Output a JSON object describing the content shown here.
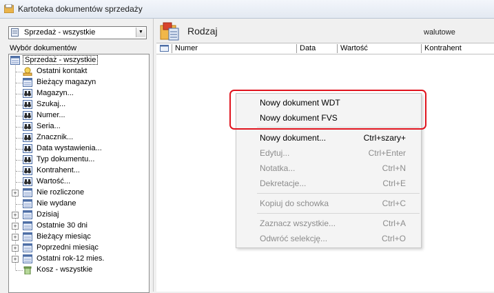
{
  "window": {
    "title": "Kartoteka dokumentów sprzedaży"
  },
  "left": {
    "combo_value": "Sprzedaż - wszystkie",
    "section_label": "Wybór dokumentów",
    "tree_root": "Sprzedaż - wszystkie",
    "tree_children": [
      "Ostatni kontakt",
      "Bieżący magazyn",
      "Magazyn...",
      "Szukaj...",
      "Numer...",
      "Seria...",
      "Znacznik...",
      "Data wystawienia...",
      "Typ dokumentu...",
      "Kontrahent...",
      "Wartość..."
    ],
    "tree_top": [
      "Nie rozliczone",
      "Nie wydane",
      "Dzisiaj",
      "Ostatnie 30 dni",
      "Bieżący miesiąc",
      "Poprzedni miesiąc",
      "Ostatni rok-12 mies.",
      "Kosz - wszystkie"
    ]
  },
  "right": {
    "title": "Rodzaj",
    "walutowe": "walutowe",
    "columns": [
      "Numer",
      "Data",
      "Wartość",
      "Kontrahent"
    ]
  },
  "context_menu": {
    "items": [
      {
        "label": "Nowy dokument WDT",
        "shortcut": ""
      },
      {
        "label": "Nowy dokument FVS",
        "shortcut": ""
      },
      {
        "label": "Nowy dokument...",
        "shortcut": "Ctrl+szary+"
      },
      {
        "label": "Edytuj...",
        "shortcut": "Ctrl+Enter"
      },
      {
        "label": "Notatka...",
        "shortcut": "Ctrl+N"
      },
      {
        "label": "Dekretacje...",
        "shortcut": "Ctrl+E"
      },
      {
        "label": "Kopiuj do schowka",
        "shortcut": "Ctrl+C"
      },
      {
        "label": "Zaznacz wszystkie...",
        "shortcut": "Ctrl+A"
      },
      {
        "label": "Odwróć selekcję...",
        "shortcut": "Ctrl+O"
      }
    ]
  },
  "colors": {
    "highlight": "#e0131d",
    "menu_bg": "#f4f4f4",
    "disabled": "#8c8c8c"
  }
}
